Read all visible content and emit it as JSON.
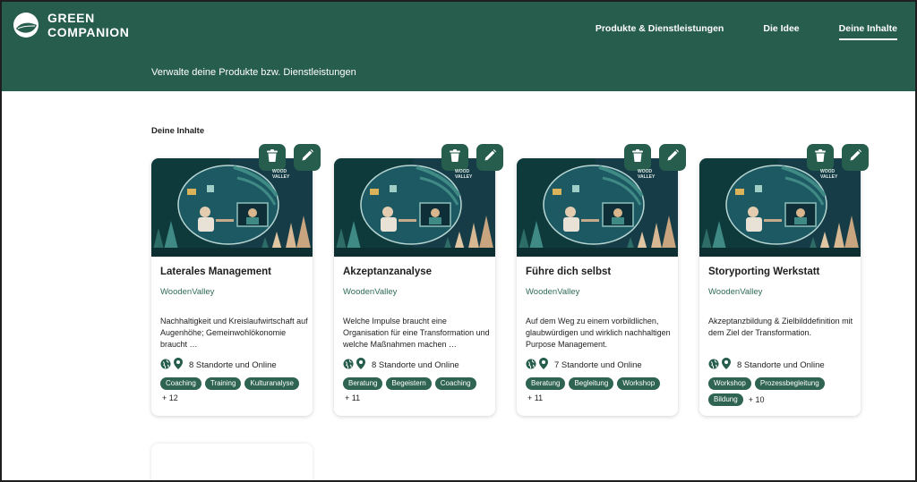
{
  "brand": {
    "line1": "GREEN",
    "line2": "COMPANION"
  },
  "nav": [
    {
      "label": "Produkte & Dienstleistungen"
    },
    {
      "label": "Die Idee"
    },
    {
      "label": "Deine Inhalte"
    }
  ],
  "subtitle": "Verwalte deine Produkte bzw. Dienstleistungen",
  "section_title": "Deine Inhalte",
  "image_logo_text": "WOOD VALLEY",
  "cards": [
    {
      "title": "Laterales Management",
      "company": "WoodenValley",
      "desc": "Nachhaltigkeit und Kreislaufwirtschaft auf Augenhöhe; Gemeinwohlökonomie braucht …",
      "location": "8 Standorte und Online",
      "tags": [
        "Coaching",
        "Training",
        "Kulturanalyse"
      ],
      "more": "+ 12"
    },
    {
      "title": "Akzeptanzanalyse",
      "company": "WoodenValley",
      "desc": "Welche Impulse braucht eine Organisation für eine Transformation und welche Maßnahmen machen …",
      "location": "8 Standorte und Online",
      "tags": [
        "Beratung",
        "Begeistern",
        "Coaching"
      ],
      "more": "+ 11"
    },
    {
      "title": "Führe dich selbst",
      "company": "WoodenValley",
      "desc": "Auf dem Weg zu einem vorbildlichen, glaubwürdigen und wirklich nachhaltigen Purpose Management.",
      "location": "7 Standorte und Online",
      "tags": [
        "Beratung",
        "Begleitung",
        "Workshop"
      ],
      "more": "+ 11"
    },
    {
      "title": "Storyporting Werkstatt",
      "company": "WoodenValley",
      "desc": "Akzeptanzbildung & Zielbilddefinition mit dem Ziel der Transformation.",
      "location": "8 Standorte und Online",
      "tags": [
        "Workshop",
        "Prozessbegleitung",
        "Bildung"
      ],
      "more": "+ 10"
    }
  ]
}
